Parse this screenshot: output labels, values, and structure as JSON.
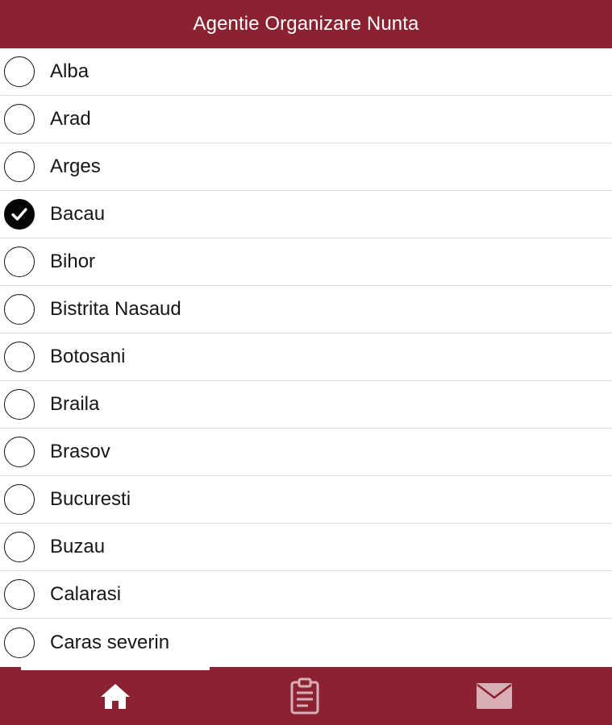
{
  "header": {
    "title": "Agentie Organizare Nunta"
  },
  "list": {
    "items": [
      {
        "label": "Alba",
        "selected": false
      },
      {
        "label": "Arad",
        "selected": false
      },
      {
        "label": "Arges",
        "selected": false
      },
      {
        "label": "Bacau",
        "selected": true
      },
      {
        "label": "Bihor",
        "selected": false
      },
      {
        "label": "Bistrita Nasaud",
        "selected": false
      },
      {
        "label": "Botosani",
        "selected": false
      },
      {
        "label": "Braila",
        "selected": false
      },
      {
        "label": "Brasov",
        "selected": false
      },
      {
        "label": "Bucuresti",
        "selected": false
      },
      {
        "label": "Buzau",
        "selected": false
      },
      {
        "label": "Calarasi",
        "selected": false
      },
      {
        "label": "Caras severin",
        "selected": false
      }
    ]
  },
  "tabbar": {
    "tabs": [
      {
        "icon": "home-icon",
        "active": true
      },
      {
        "icon": "clipboard-icon",
        "active": false
      },
      {
        "icon": "mail-icon",
        "active": false
      }
    ]
  },
  "colors": {
    "brand": "#8b2232",
    "active_icon": "#ffffff",
    "inactive_icon": "#d9aeb4",
    "checked_radio": "#050505"
  }
}
